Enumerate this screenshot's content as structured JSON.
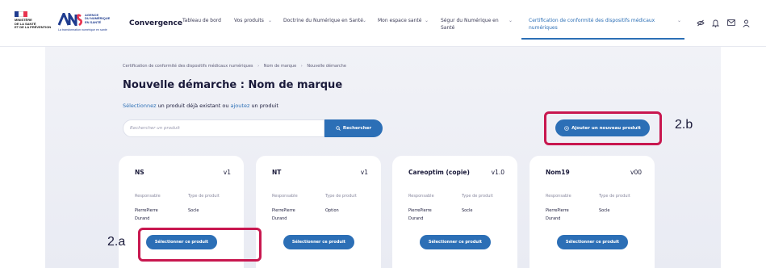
{
  "header": {
    "ministry_lines": [
      "MINISTÈRE",
      "DE LA SANTÉ",
      "ET DE LA PRÉVENTION"
    ],
    "ans_letters": "ANS",
    "ans_sub": [
      "AGENCE",
      "DU NUMÉRIQUE",
      "EN SANTÉ"
    ],
    "ans_tag": "La transformation numérique en santé",
    "brand": "Convergence",
    "nav": [
      {
        "label": "Tableau de bord"
      },
      {
        "label": "Vos produits"
      },
      {
        "label": "Doctrine du Numérique en Santé"
      },
      {
        "label": "Mon espace santé"
      },
      {
        "label": "Ségur du Numérique en Santé"
      },
      {
        "label": "Certification de conformité des dispositifs médicaux numériques"
      }
    ],
    "icons": [
      "eye-off-icon",
      "bell-icon",
      "mail-icon",
      "user-icon"
    ],
    "colors": {
      "accent": "#2c6fb6",
      "highlight": "#c8174f"
    }
  },
  "breadcrumb": [
    "Certification de conformité des dispositifs médicaux numériques",
    "Nom de marque",
    "Nouvelle démarche"
  ],
  "page_title": "Nouvelle démarche : Nom de marque",
  "subtitle": {
    "link1": "Sélectionnez",
    "text1": " un produit déjà existant ou ",
    "link2": "ajoutez",
    "text2": " un produit"
  },
  "search": {
    "placeholder": "Rechercher un produit",
    "button": "Rechercher"
  },
  "add_button": "Ajouter un nouveau produit",
  "annotations": {
    "a": "2.a",
    "b": "2.b"
  },
  "products": [
    {
      "name": "NS",
      "version": "v1",
      "responsable_label": "Responsable",
      "type_label": "Type de produit",
      "responsable": "PierrePierre Durand",
      "type": "Socle",
      "button": "Sélectionner ce produit"
    },
    {
      "name": "NT",
      "version": "v1",
      "responsable_label": "Responsable",
      "type_label": "Type de produit",
      "responsable": "PierrePierre Durand",
      "type": "Option",
      "button": "Sélectionner ce produit"
    },
    {
      "name": "Careoptim (copie)",
      "version": "v1.0",
      "responsable_label": "Responsable",
      "type_label": "Type de produit",
      "responsable": "PierrePierre Durand",
      "type": "Socle",
      "button": "Sélectionner ce produit"
    },
    {
      "name": "Nom19",
      "version": "v00",
      "responsable_label": "Responsable",
      "type_label": "Type de produit",
      "responsable": "PierrePierre Durand",
      "type": "Socle",
      "button": "Sélectionner ce produit"
    }
  ]
}
